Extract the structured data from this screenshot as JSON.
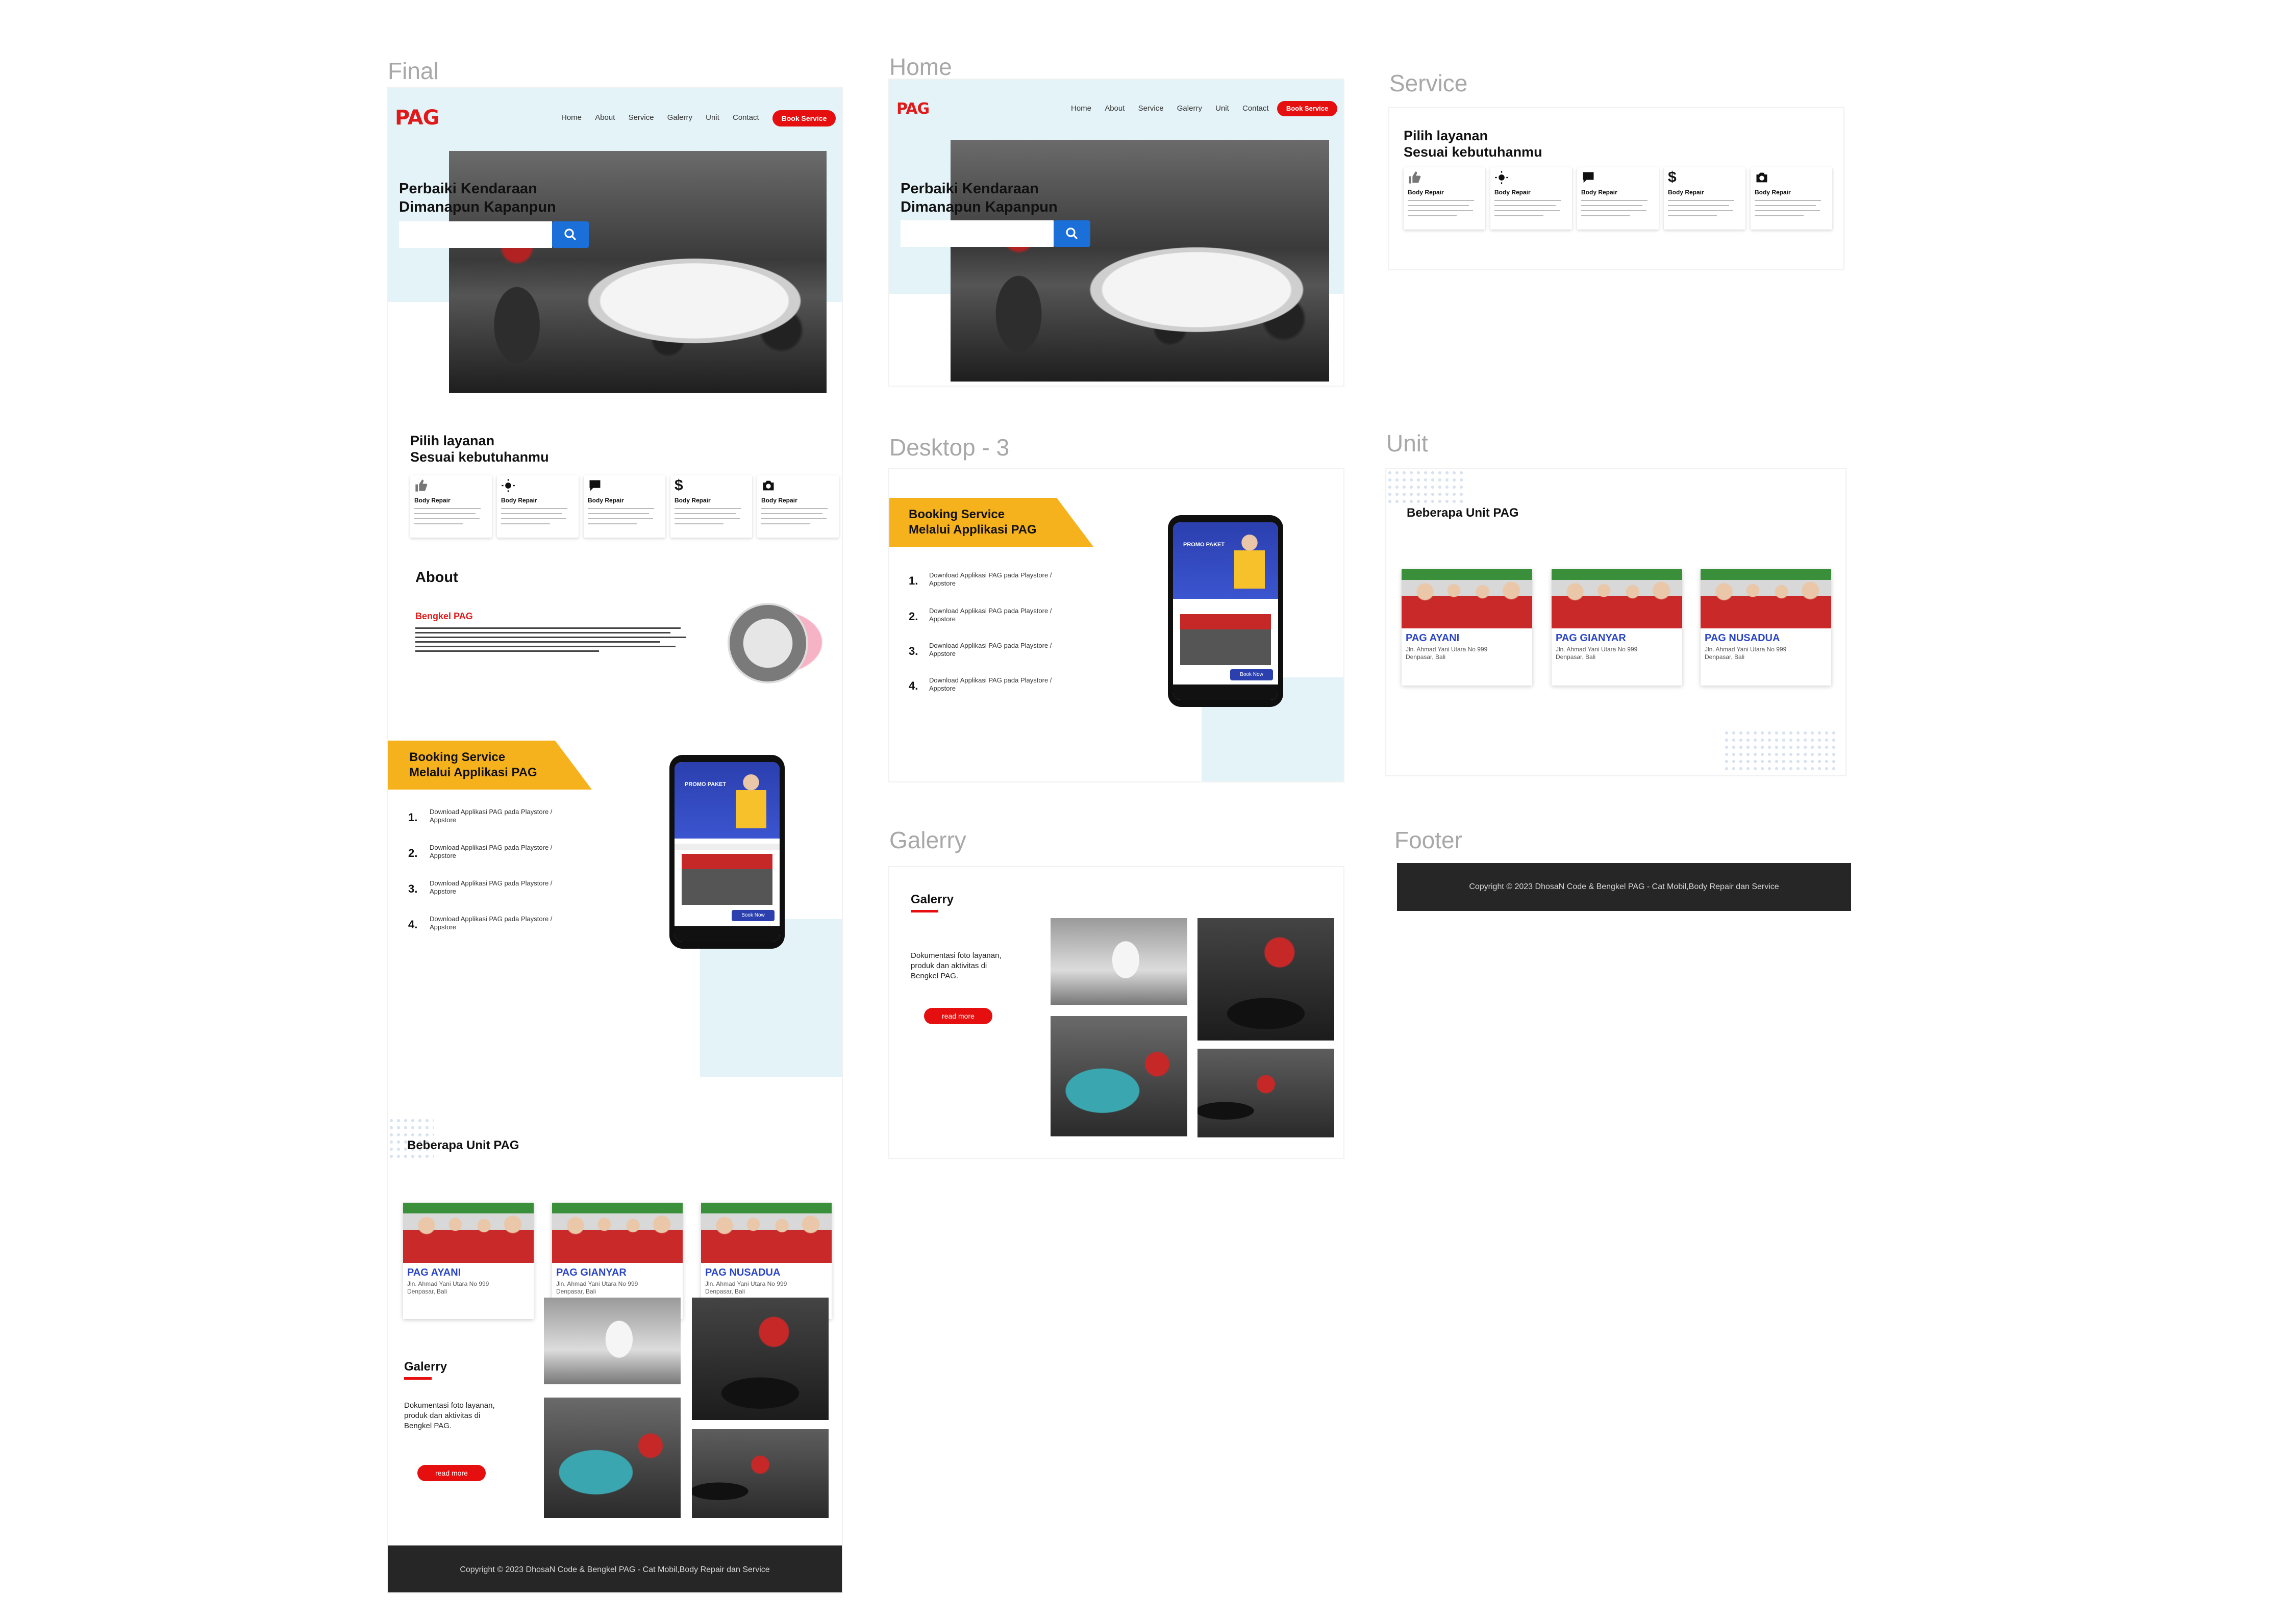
{
  "frames": {
    "final": "Final",
    "home": "Home",
    "service": "Service",
    "desktop3": "Desktop - 3",
    "unit": "Unit",
    "galerry": "Galerry",
    "footer": "Footer"
  },
  "brand": {
    "logo": "PAG",
    "accent": "#e60f0f",
    "blue": "#1b6fd8",
    "yellow": "#f6b21d"
  },
  "nav": {
    "items": [
      "Home",
      "About",
      "Service",
      "Galerry",
      "Unit",
      "Contact"
    ],
    "cta": "Book Service"
  },
  "hero": {
    "title_line1": "Perbaiki  Kendaraan",
    "title_line2": "Dimanapun Kapanpun",
    "search_icon": "search-icon"
  },
  "service": {
    "title_line1": "Pilih layanan",
    "title_line2": "Sesuai kebutuhanmu",
    "cards": [
      {
        "icon": "thumbs-up-icon",
        "title": "Body Repair"
      },
      {
        "icon": "sun-icon",
        "title": "Body Repair"
      },
      {
        "icon": "chat-icon",
        "title": "Body Repair"
      },
      {
        "icon": "dollar-icon",
        "glyph": "$",
        "title": "Body Repair"
      },
      {
        "icon": "camera-icon",
        "title": "Body Repair"
      }
    ]
  },
  "about": {
    "title": "About",
    "subtitle": "Bengkel PAG"
  },
  "booking": {
    "title_line1": "Booking Service",
    "title_line2": "Melalui Applikasi PAG",
    "steps": [
      {
        "num": "1.",
        "line1": "Download Applikasi PAG pada Playstore /",
        "line2": "Appstore"
      },
      {
        "num": "2.",
        "line1": "Download Applikasi PAG pada Playstore /",
        "line2": "Appstore"
      },
      {
        "num": "3.",
        "line1": "Download Applikasi PAG pada Playstore /",
        "line2": "Appstore"
      },
      {
        "num": "4.",
        "line1": "Download Applikasi PAG pada Playstore /",
        "line2": "Appstore"
      }
    ],
    "phone": {
      "promo": "PROMO PAKET",
      "book_now": "Book Now"
    }
  },
  "units": {
    "title": "Beberapa Unit PAG",
    "items": [
      {
        "name": "PAG AYANI",
        "addr1": "Jln. Ahmad Yani Utara No 999",
        "addr2": "Denpasar, Bali"
      },
      {
        "name": "PAG GIANYAR",
        "addr1": "Jln. Ahmad Yani Utara No 999",
        "addr2": "Denpasar, Bali"
      },
      {
        "name": "PAG NUSADUA",
        "addr1": "Jln. Ahmad Yani Utara No 999",
        "addr2": "Denpasar, Bali"
      }
    ]
  },
  "gallery": {
    "title": "Galerry",
    "desc_line1": "Dokumentasi foto layanan,",
    "desc_line2": "produk dan aktivitas di",
    "desc_line3": "Bengkel PAG.",
    "button": "read more"
  },
  "footer": {
    "copyright": "Copyright © 2023 DhosaN Code & Bengkel PAG - Cat Mobil,Body Repair dan Service"
  }
}
